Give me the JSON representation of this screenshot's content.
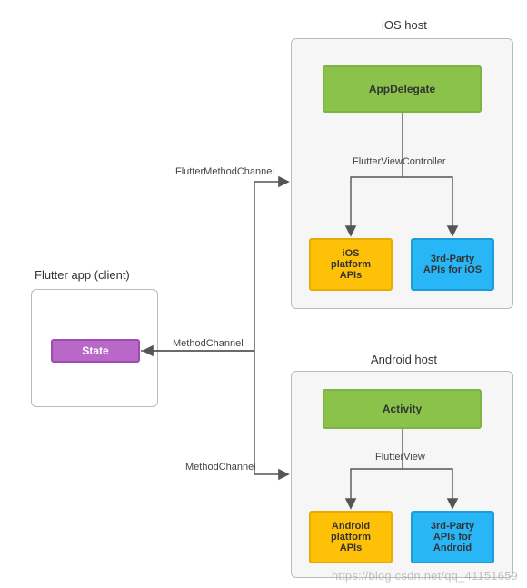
{
  "client": {
    "label": "Flutter app (client)",
    "state_label": "State"
  },
  "ios": {
    "title": "iOS host",
    "delegate": "AppDelegate",
    "fvc_label": "FlutterViewController",
    "platform_apis": "iOS\nplatform\nAPIs",
    "third_party": "3rd-Party\nAPIs for iOS"
  },
  "android": {
    "title": "Android host",
    "activity": "Activity",
    "fv_label": "FlutterView",
    "platform_apis": "Android\nplatform\nAPIs",
    "third_party": "3rd-Party\nAPIs for\nAndroid"
  },
  "channels": {
    "ios_out": "FlutterMethodChannel",
    "middle": "MethodChannel",
    "android_out": "MethodChannel"
  },
  "watermark": "https://blog.csdn.net/qq_41151659",
  "colors": {
    "green": "#8bc34a",
    "yellow": "#ffc107",
    "blue": "#29b6f6",
    "purple": "#ba68c8",
    "border": "#bbb"
  },
  "chart_data": {
    "type": "diagram",
    "title": "Flutter platform channel architecture",
    "nodes": [
      {
        "id": "flutter_app",
        "label": "Flutter app (client)",
        "type": "container"
      },
      {
        "id": "state",
        "label": "State",
        "parent": "flutter_app",
        "color": "purple"
      },
      {
        "id": "ios_host",
        "label": "iOS host",
        "type": "container"
      },
      {
        "id": "app_delegate",
        "label": "AppDelegate",
        "parent": "ios_host",
        "color": "green"
      },
      {
        "id": "ios_platform_apis",
        "label": "iOS platform APIs",
        "parent": "ios_host",
        "color": "yellow"
      },
      {
        "id": "ios_third_party",
        "label": "3rd-Party APIs for iOS",
        "parent": "ios_host",
        "color": "blue"
      },
      {
        "id": "android_host",
        "label": "Android host",
        "type": "container"
      },
      {
        "id": "activity",
        "label": "Activity",
        "parent": "android_host",
        "color": "green"
      },
      {
        "id": "android_platform_apis",
        "label": "Android platform APIs",
        "parent": "android_host",
        "color": "yellow"
      },
      {
        "id": "android_third_party",
        "label": "3rd-Party APIs for Android",
        "parent": "android_host",
        "color": "blue"
      }
    ],
    "edges": [
      {
        "from": "state",
        "to": "ios_host",
        "label": "FlutterMethodChannel",
        "bidirectional": false,
        "direction": "to_ios"
      },
      {
        "from": "ios_host",
        "to": "state",
        "via": "middle",
        "label": "MethodChannel",
        "bidirectional": false
      },
      {
        "from": "state",
        "to": "android_host",
        "label": "MethodChannel",
        "bidirectional": false,
        "direction": "to_android"
      },
      {
        "from": "app_delegate",
        "to": "ios_platform_apis",
        "label": "FlutterViewController"
      },
      {
        "from": "app_delegate",
        "to": "ios_third_party",
        "label": "FlutterViewController"
      },
      {
        "from": "activity",
        "to": "android_platform_apis",
        "label": "FlutterView"
      },
      {
        "from": "activity",
        "to": "android_third_party",
        "label": "FlutterView"
      }
    ]
  }
}
